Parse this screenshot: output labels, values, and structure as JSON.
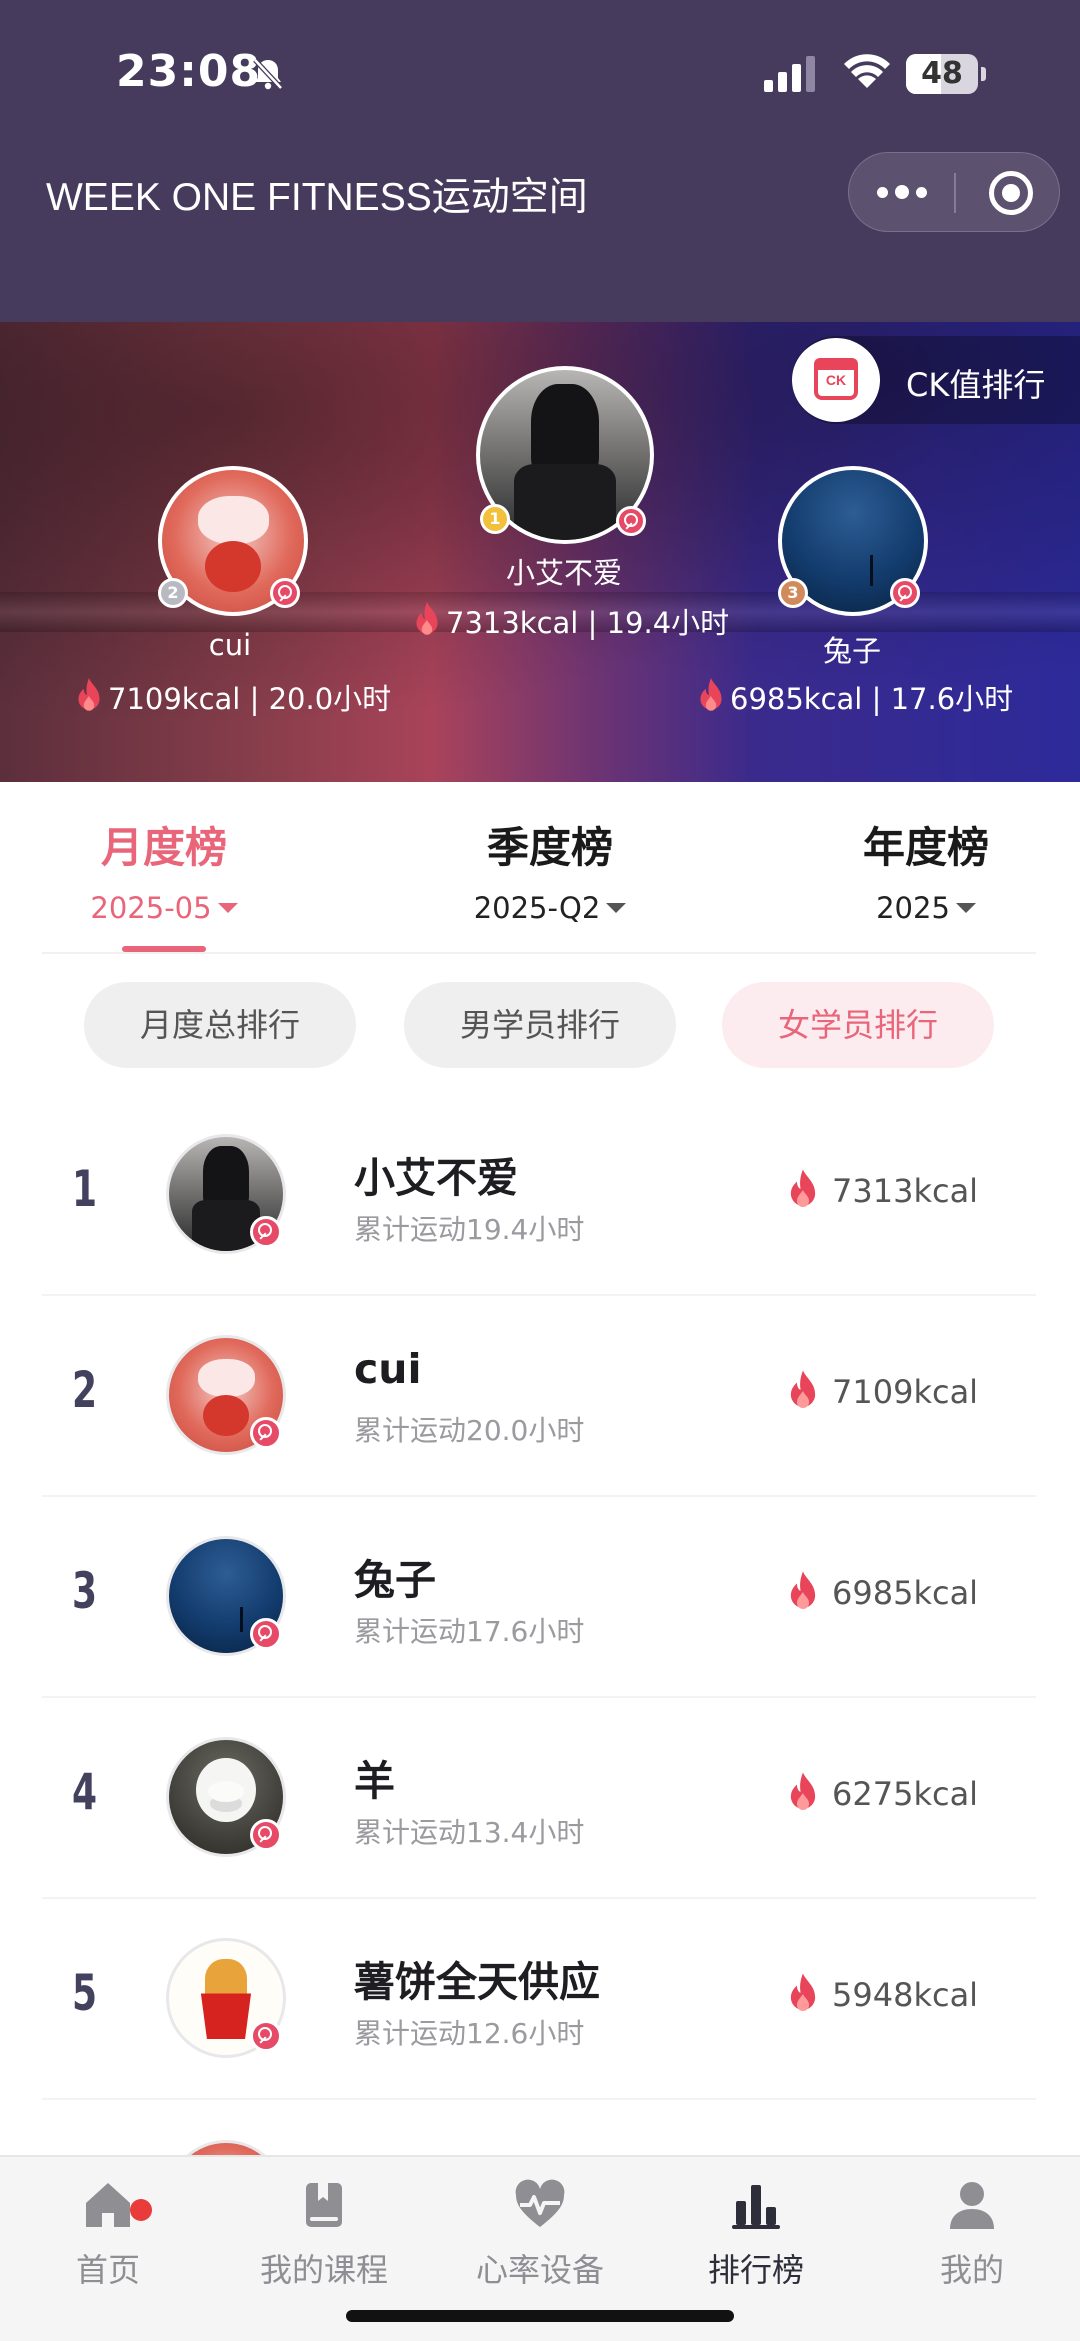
{
  "status_bar": {
    "time": "23:08",
    "battery": "48",
    "battery_level": 0.48,
    "icons": [
      "bell-off-icon",
      "signal-icon",
      "wifi-icon",
      "battery-icon"
    ]
  },
  "header": {
    "title": "WEEK ONE FITNESS运动空间",
    "capsule_icons": [
      "more-icon",
      "target-icon"
    ]
  },
  "hero": {
    "ck_label": "CK值排行",
    "ck_icon_text": "CK",
    "podium": [
      {
        "rank": "1",
        "name": "小艾不爱",
        "stat": "7313kcal | 19.4小时"
      },
      {
        "rank": "2",
        "name": "cui",
        "stat": "7109kcal | 20.0小时"
      },
      {
        "rank": "3",
        "name": "兔子",
        "stat": "6985kcal | 17.6小时"
      }
    ]
  },
  "tabs": [
    {
      "label": "月度榜",
      "period": "2025-05",
      "active": true
    },
    {
      "label": "季度榜",
      "period": "2025-Q2",
      "active": false
    },
    {
      "label": "年度榜",
      "period": "2025",
      "active": false
    }
  ],
  "filters": [
    {
      "label": "月度总排行",
      "active": false
    },
    {
      "label": "男学员排行",
      "active": false
    },
    {
      "label": "女学员排行",
      "active": true
    }
  ],
  "ranking": [
    {
      "rank": "1",
      "name": "小艾不爱",
      "sub": "累计运动19.4小时",
      "kcal": "7313kcal"
    },
    {
      "rank": "2",
      "name": "cui",
      "sub": "累计运动20.0小时",
      "kcal": "7109kcal"
    },
    {
      "rank": "3",
      "name": "兔子",
      "sub": "累计运动17.6小时",
      "kcal": "6985kcal"
    },
    {
      "rank": "4",
      "name": "羊",
      "sub": "累计运动13.4小时",
      "kcal": "6275kcal"
    },
    {
      "rank": "5",
      "name": "薯饼全天供应",
      "sub": "累计运动12.6小时",
      "kcal": "5948kcal"
    }
  ],
  "nav": [
    {
      "label": "首页",
      "icon": "home-icon",
      "badge": true
    },
    {
      "label": "我的课程",
      "icon": "book-icon"
    },
    {
      "label": "心率设备",
      "icon": "heart-rate-icon"
    },
    {
      "label": "排行榜",
      "icon": "bar-chart-icon",
      "active": true
    },
    {
      "label": "我的",
      "icon": "user-icon"
    }
  ],
  "colors": {
    "accent": "#e8657a",
    "header_bg": "#463b5c",
    "flame": "#e8455a",
    "gold": "#f2c03a",
    "silver": "#b9b9c2",
    "bronze": "#d08a5c"
  }
}
